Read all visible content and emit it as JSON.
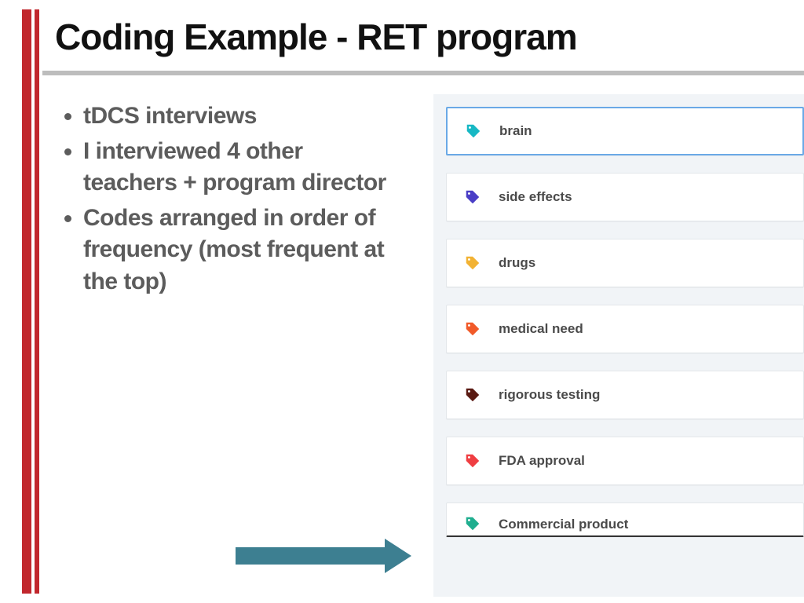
{
  "title": "Coding Example - RET program",
  "bullets": [
    "tDCS interviews",
    "I interviewed 4 other teachers + program director",
    "Codes arranged in order of frequency (most frequent at the top)"
  ],
  "tags": [
    {
      "label": "brain",
      "color": "#17b8c4",
      "selected": true
    },
    {
      "label": "side effects",
      "color": "#4a3ec6",
      "selected": false
    },
    {
      "label": "drugs",
      "color": "#f2b233",
      "selected": false
    },
    {
      "label": "medical need",
      "color": "#f15a29",
      "selected": false
    },
    {
      "label": "rigorous testing",
      "color": "#5a1a12",
      "selected": false
    },
    {
      "label": "FDA approval",
      "color": "#ef3e42",
      "selected": false
    },
    {
      "label": "Commercial product",
      "color": "#1fae8f",
      "selected": false
    }
  ],
  "colors": {
    "accent_red": "#c1272d",
    "arrow": "#3d7f91",
    "divider": "#bdbdbd",
    "panel_bg": "#f1f4f7",
    "selected_border": "#6aa9e6"
  }
}
